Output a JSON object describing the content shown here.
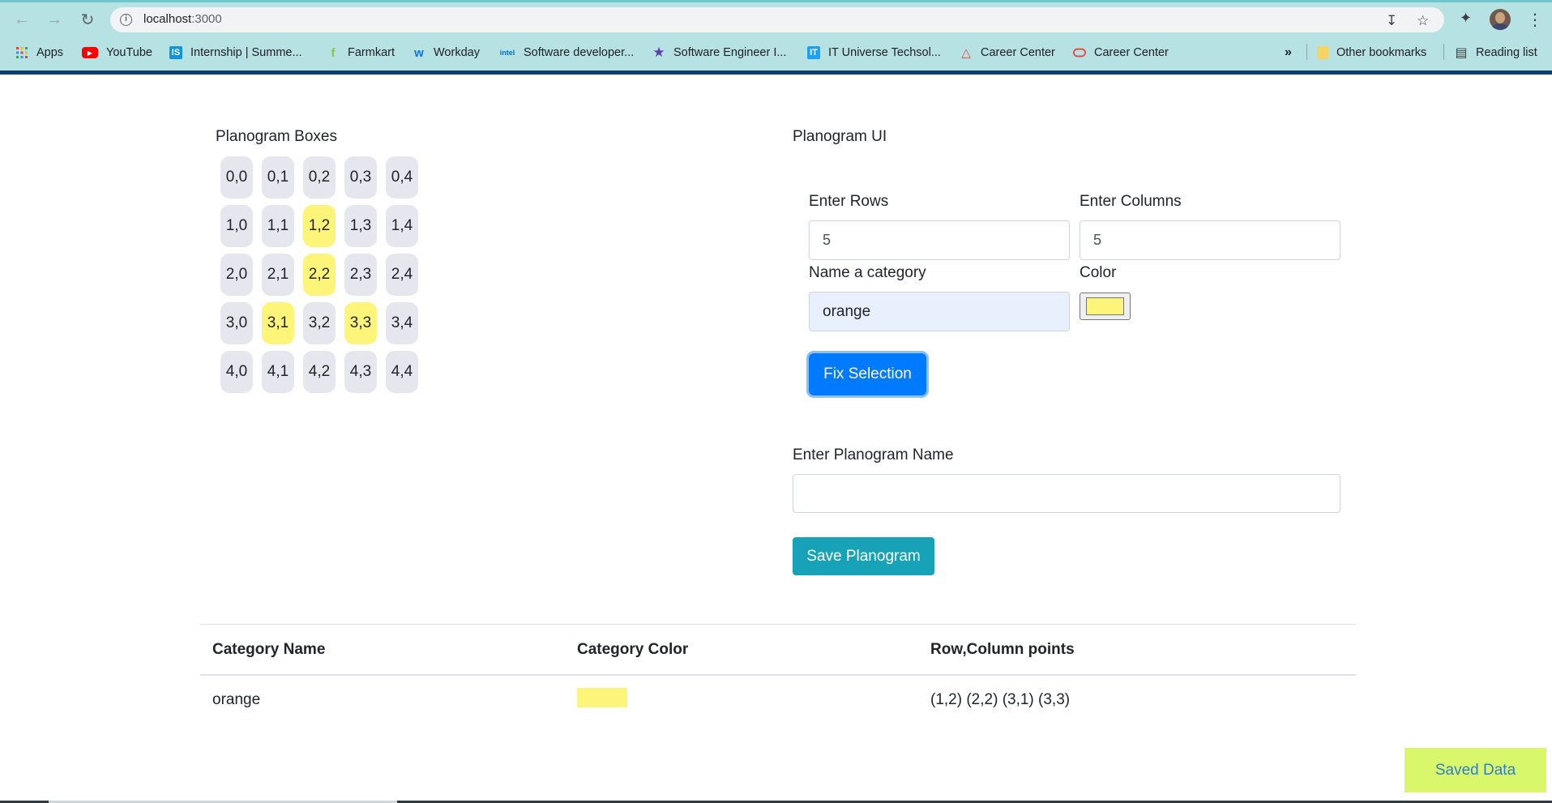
{
  "browser": {
    "url_host": "localhost",
    "url_port": ":3000",
    "bookmarks": [
      {
        "label": "Apps",
        "icon": "apps-grid-icon",
        "color": "#e8453c"
      },
      {
        "label": "YouTube",
        "icon": "youtube-icon",
        "color": "#ff0000"
      },
      {
        "label": "Internship | Summe...",
        "icon": "internshala-icon",
        "color": "#1295d8"
      },
      {
        "label": "Farmkart",
        "icon": "farmkart-icon",
        "color": "#8bc34a"
      },
      {
        "label": "Workday",
        "icon": "workday-icon",
        "color": "#f5a623"
      },
      {
        "label": "Software developer...",
        "icon": "intel-icon",
        "color": "#0071c5"
      },
      {
        "label": "Software Engineer I...",
        "icon": "star-icon",
        "color": "#5b3fb5"
      },
      {
        "label": "IT Universe Techsol...",
        "icon": "it-universe-icon",
        "color": "#1da1f2"
      },
      {
        "label": "Career Center",
        "icon": "career-center-triangle-icon",
        "color": "#e8453c"
      },
      {
        "label": "Career Center",
        "icon": "oracle-icon",
        "color": "#e8453c"
      }
    ],
    "overflow_label": "»",
    "other_bookmarks": "Other bookmarks",
    "reading_list": "Reading list"
  },
  "boxes": {
    "title": "Planogram Boxes",
    "rows": [
      [
        {
          "label": "0,0",
          "selected": false
        },
        {
          "label": "0,1",
          "selected": false
        },
        {
          "label": "0,2",
          "selected": false
        },
        {
          "label": "0,3",
          "selected": false
        },
        {
          "label": "0,4",
          "selected": false
        }
      ],
      [
        {
          "label": "1,0",
          "selected": false
        },
        {
          "label": "1,1",
          "selected": false
        },
        {
          "label": "1,2",
          "selected": true
        },
        {
          "label": "1,3",
          "selected": false
        },
        {
          "label": "1,4",
          "selected": false
        }
      ],
      [
        {
          "label": "2,0",
          "selected": false
        },
        {
          "label": "2,1",
          "selected": false
        },
        {
          "label": "2,2",
          "selected": true
        },
        {
          "label": "2,3",
          "selected": false
        },
        {
          "label": "2,4",
          "selected": false
        }
      ],
      [
        {
          "label": "3,0",
          "selected": false
        },
        {
          "label": "3,1",
          "selected": true
        },
        {
          "label": "3,2",
          "selected": false
        },
        {
          "label": "3,3",
          "selected": true
        },
        {
          "label": "3,4",
          "selected": false
        }
      ],
      [
        {
          "label": "4,0",
          "selected": false
        },
        {
          "label": "4,1",
          "selected": false
        },
        {
          "label": "4,2",
          "selected": false
        },
        {
          "label": "4,3",
          "selected": false
        },
        {
          "label": "4,4",
          "selected": false
        }
      ]
    ],
    "selected_color": "#fdf579"
  },
  "form": {
    "title": "Planogram UI",
    "rows_label": "Enter Rows",
    "rows_value": "5",
    "columns_label": "Enter Columns",
    "columns_value": "5",
    "category_label": "Name a category",
    "category_value": "orange",
    "color_label": "Color",
    "color_value": "#fdf579",
    "fix_button": "Fix Selection",
    "name_label": "Enter Planogram Name",
    "name_value": "",
    "save_button": "Save Planogram"
  },
  "table": {
    "headers": [
      "Category Name",
      "Category Color",
      "Row,Column points"
    ],
    "rows": [
      {
        "name": "orange",
        "color": "#fdf579",
        "points": "(1,2) (2,2) (3,1) (3,3)"
      }
    ]
  },
  "saved_data_label": "Saved Data"
}
